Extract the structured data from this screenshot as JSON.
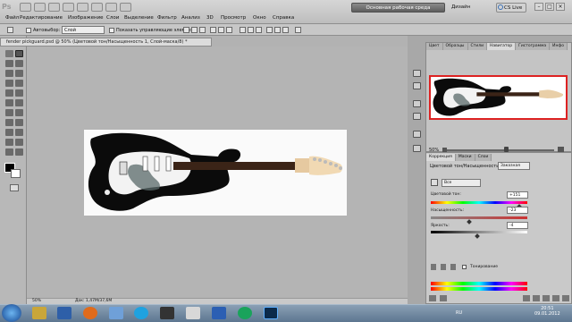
{
  "app": {
    "logo": "Ps"
  },
  "menu": [
    "Файл",
    "Редактирование",
    "Изображение",
    "Слои",
    "Выделение",
    "Фильтр",
    "Анализ",
    "3D",
    "Просмотр",
    "Окно",
    "Справка"
  ],
  "workspace": {
    "active": "Основная рабочая среда",
    "design": "Дизайн",
    "cslive": "CS Live"
  },
  "window_controls": {
    "minimize": "–",
    "maximize": "□",
    "close": "×"
  },
  "options": {
    "autoselect_label": "Автовыбор:",
    "layer_select": "Слой",
    "show_controls_label": "Показать управляющие элементы"
  },
  "document": {
    "tab_title": "fender pickguard.psd @ 50% (Цветовой тон/Насыщенность 1, Слой-маска/8) *",
    "zoom": "50%",
    "doc_size": "Док: 1,47M/37,6M"
  },
  "navigator": {
    "tabs": [
      "Цвет",
      "Образцы",
      "Стили",
      "Навигатор",
      "Гистограмма",
      "Инфо"
    ],
    "active_tab": 3,
    "zoom": "50%",
    "zoom_level": 0.55
  },
  "adjustments": {
    "tabs": [
      "Коррекция",
      "Маски",
      "Слои"
    ],
    "title": "Цветовой тон/Насыщенность",
    "preset": "Заказная",
    "channel": "Все",
    "hue_label": "Цветовой тон:",
    "hue_value": "+151",
    "hue_fraction": 0.92,
    "saturation_label": "Насыщенность:",
    "saturation_value": "-23",
    "saturation_fraction": 0.4,
    "lightness_label": "Яркость:",
    "lightness_value": "-4",
    "lightness_fraction": 0.48,
    "colorize_label": "Тонирование"
  },
  "taskbar": {
    "lang": "RU",
    "time": "20:51",
    "date": "09.01.2012"
  },
  "colors": {
    "foreground": "#000000",
    "background": "#ffffff",
    "nav_frame": "#dd2222"
  }
}
